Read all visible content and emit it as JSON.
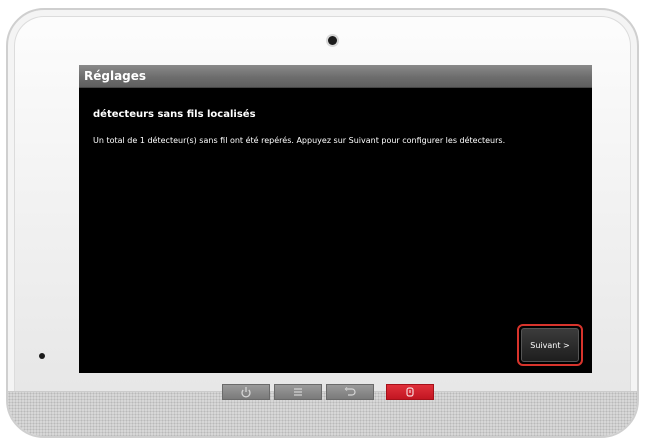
{
  "screen": {
    "title": "Réglages",
    "heading": "détecteurs sans fils localisés",
    "message": "Un total de 1 détecteur(s) sans fil ont été repérés. Appuyez sur Suivant pour configurer les détecteurs.",
    "next_label": "Suivant >"
  },
  "hardware_buttons": [
    {
      "icon": "home-icon"
    },
    {
      "icon": "menu-icon"
    },
    {
      "icon": "back-icon"
    },
    {
      "icon": "panic-icon",
      "color": "#d2232e"
    }
  ],
  "colors": {
    "highlight": "#d8342c",
    "screen_background": "#000000"
  }
}
